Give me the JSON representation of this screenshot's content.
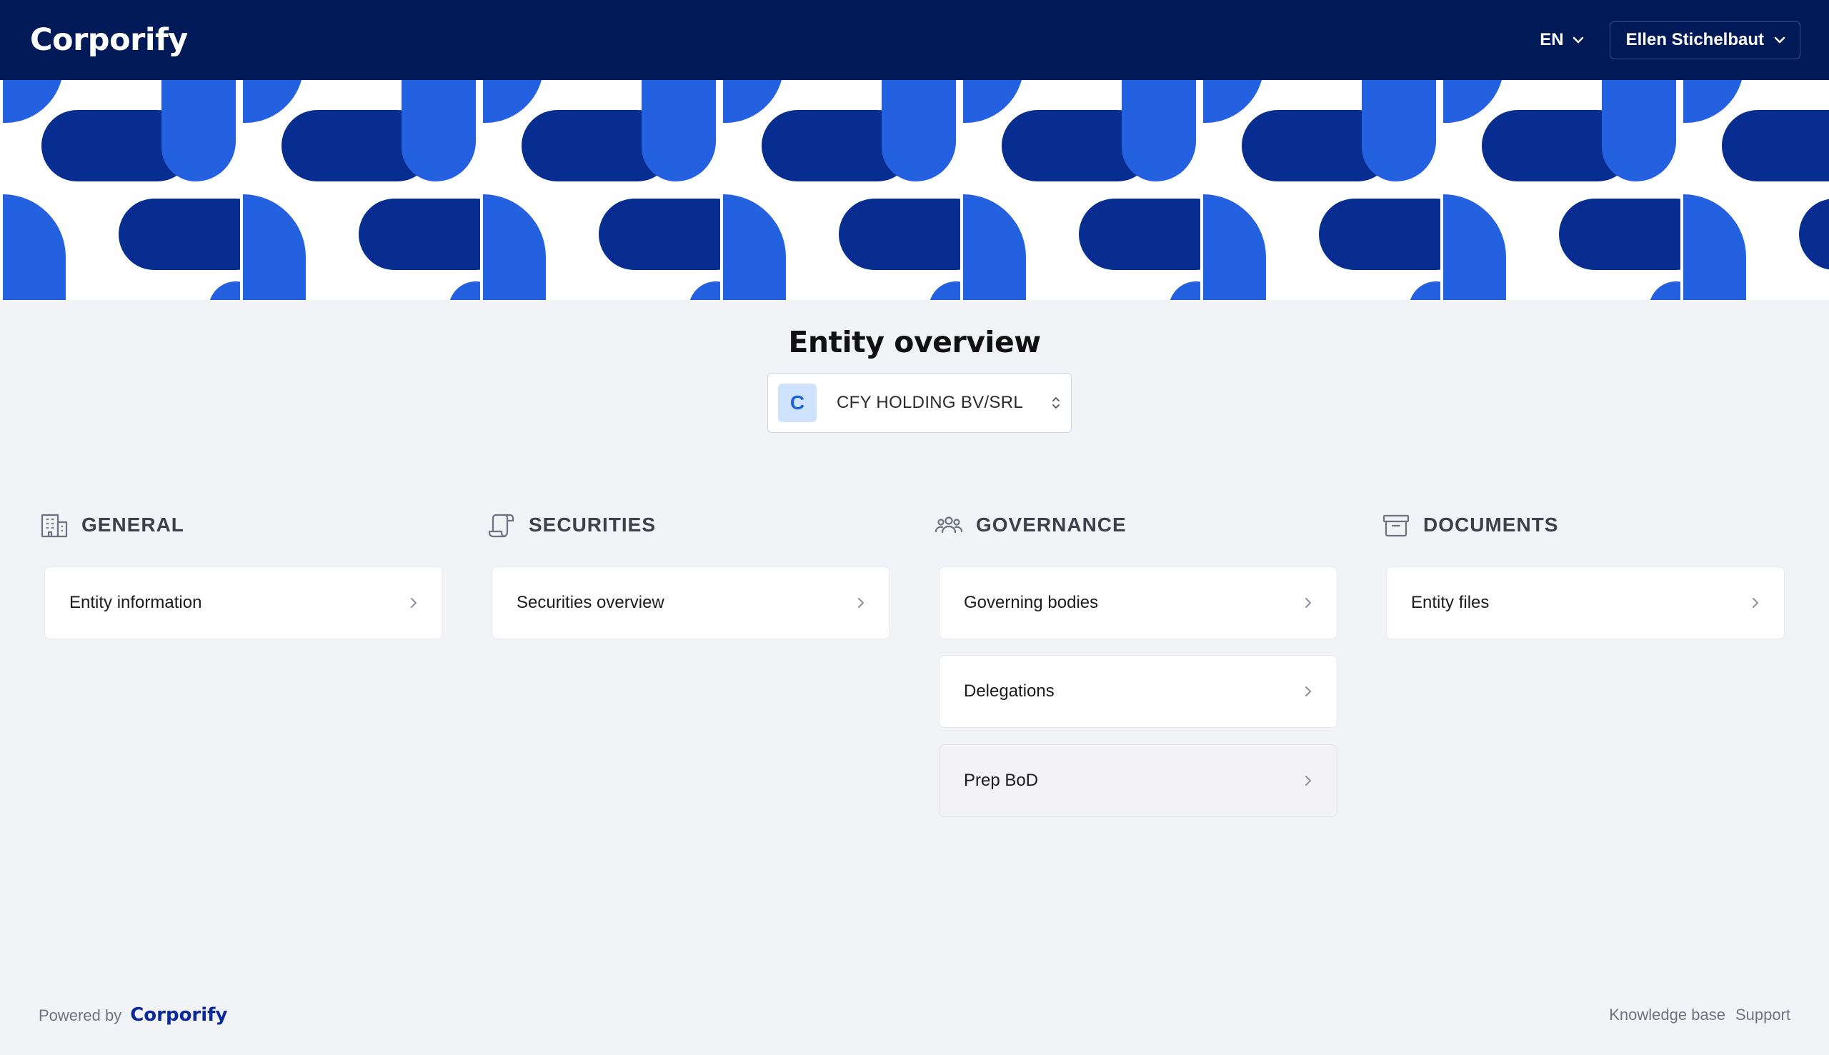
{
  "header": {
    "brand": "Corporify",
    "language": "EN",
    "user_name": "Ellen Stichelbaut"
  },
  "page": {
    "title": "Entity overview"
  },
  "entity_selector": {
    "avatar_letter": "C",
    "selected": "CFY HOLDING BV/SRL"
  },
  "sections": [
    {
      "title": "GENERAL",
      "icon": "building-icon",
      "items": [
        {
          "label": "Entity information"
        }
      ]
    },
    {
      "title": "SECURITIES",
      "icon": "scroll-icon",
      "items": [
        {
          "label": "Securities overview"
        }
      ]
    },
    {
      "title": "GOVERNANCE",
      "icon": "users-icon",
      "items": [
        {
          "label": "Governing bodies"
        },
        {
          "label": "Delegations"
        },
        {
          "label": "Prep BoD"
        }
      ]
    },
    {
      "title": "DOCUMENTS",
      "icon": "archive-box-icon",
      "items": [
        {
          "label": "Entity files"
        }
      ]
    }
  ],
  "footer": {
    "powered_by": "Powered by",
    "brand": "Corporify",
    "links": [
      "Knowledge base",
      "Support"
    ]
  },
  "colors": {
    "navbar": "#001a57",
    "banner_dark": "#062d8f",
    "banner_light": "#2361e0",
    "accent": "#1a64d8"
  }
}
